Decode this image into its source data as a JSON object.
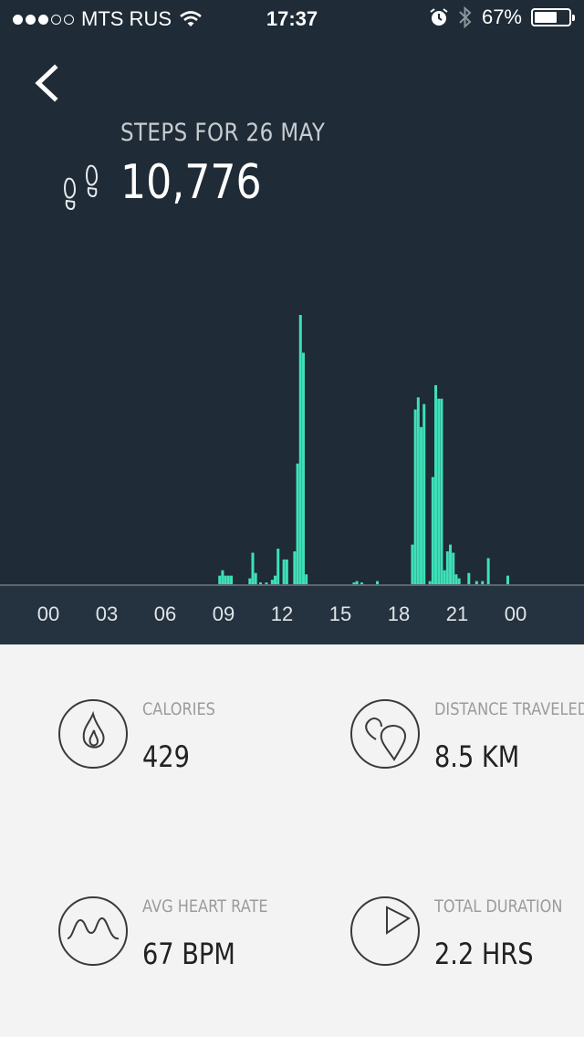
{
  "status_bar": {
    "carrier": "MTS RUS",
    "time": "17:37",
    "battery_text": "67%",
    "battery_level": 0.67,
    "signal_bars": 3,
    "signal_total": 5
  },
  "header": {
    "title": "STEPS FOR 26 MAY",
    "steps_value": "10,776",
    "back_icon": "chevron-left-icon",
    "steps_icon": "footprints-icon"
  },
  "colors": {
    "background_top": "#1f2b36",
    "axis_band": "#253340",
    "bar": "#3ee0b8",
    "background_bottom": "#f3f3f3"
  },
  "chart_data": {
    "type": "bar",
    "x_ticks": [
      "00",
      "03",
      "06",
      "09",
      "12",
      "15",
      "18",
      "21",
      "00"
    ],
    "x_unit": "hour of day",
    "xlim": [
      0,
      24
    ],
    "values_note": "relative bar heights per time bin, 0-100 scale",
    "x": [
      8.8,
      8.95,
      9.1,
      9.25,
      9.4,
      10.35,
      10.5,
      10.65,
      10.9,
      11.2,
      11.5,
      11.65,
      11.8,
      12.1,
      12.25,
      12.4,
      12.65,
      12.8,
      12.95,
      13.1,
      13.25,
      13.4,
      15.7,
      15.85,
      16.1,
      16.9,
      18.7,
      18.85,
      19.0,
      19.15,
      19.3,
      19.45,
      19.6,
      19.75,
      19.9,
      20.05,
      20.2,
      20.35,
      20.5,
      20.65,
      20.8,
      20.95,
      21.1,
      21.6,
      22.0,
      22.3,
      22.6,
      23.6
    ],
    "values": [
      3.5,
      5.5,
      3.5,
      3.5,
      3.5,
      2.5,
      12,
      4.5,
      1,
      1,
      2,
      3.5,
      13.5,
      9.5,
      9.5,
      0,
      12.5,
      45,
      100,
      86,
      4,
      0,
      1,
      1.5,
      1,
      1.5,
      15,
      65,
      69.5,
      58.5,
      67,
      0,
      1.5,
      40,
      74,
      69,
      69,
      5.5,
      12.5,
      15,
      12,
      4,
      2.5,
      4.5,
      1.5,
      1.5,
      10,
      3.5
    ],
    "ylim": [
      0,
      100
    ]
  },
  "stats": [
    {
      "label": "CALORIES",
      "value": "429",
      "icon": "flame-icon"
    },
    {
      "label": "DISTANCE TRAVELED",
      "value": "8.5 KM",
      "icon": "map-pins-icon"
    },
    {
      "label": "AVG HEART RATE",
      "value": "67 BPM",
      "icon": "heart-wave-icon"
    },
    {
      "label": "TOTAL DURATION",
      "value": "2.2 HRS",
      "icon": "clock-pie-icon"
    }
  ]
}
